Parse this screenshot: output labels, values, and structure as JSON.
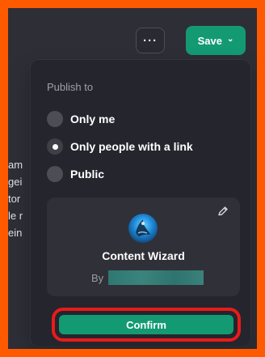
{
  "header": {
    "more_label": "···",
    "save_label": "Save",
    "save_chevron": "⌄"
  },
  "background": {
    "lines": [
      "am",
      "gei",
      "tor",
      "le r",
      "ein"
    ]
  },
  "publish": {
    "title": "Publish to",
    "options": [
      {
        "label": "Only me",
        "selected": false
      },
      {
        "label": "Only people with a link",
        "selected": true
      },
      {
        "label": "Public",
        "selected": false
      }
    ]
  },
  "assistant_card": {
    "name": "Content Wizard",
    "by_label": "By",
    "author_redacted": true
  },
  "actions": {
    "confirm_label": "Confirm"
  },
  "colors": {
    "outer_highlight": "#ff5a00",
    "confirm_highlight": "#e91b1b",
    "accent_green": "#139a73",
    "panel_dark": "#25252d",
    "card_dark": "#303039"
  },
  "icons": {
    "more": "more-options-icon",
    "save_dropdown": "chevron-down-icon",
    "edit": "pencil-icon",
    "assistant_avatar": "wizard-logo-icon"
  }
}
